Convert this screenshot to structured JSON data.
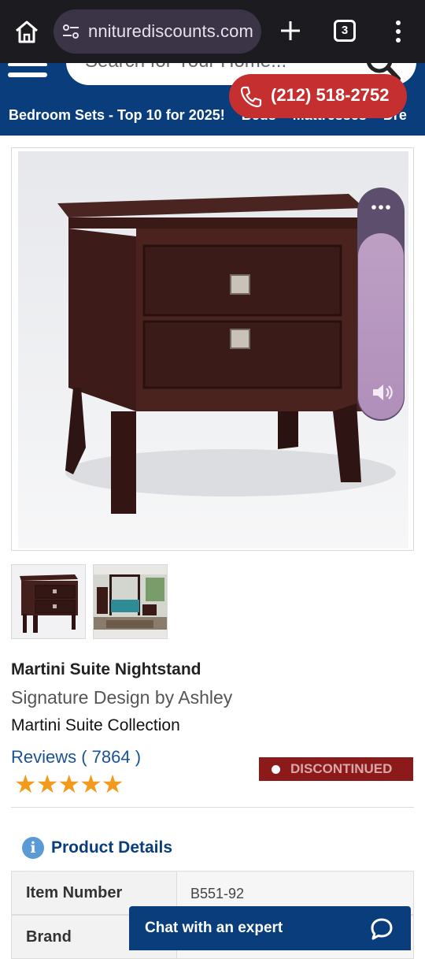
{
  "browser": {
    "url": "nniturediscounts.com",
    "tab_count": "3"
  },
  "header": {
    "search_placeholder": "Search for Your Home...",
    "phone": "(212) 518-2752",
    "nav": [
      "Bedroom Sets - Top 10 for 2025!",
      "Beds",
      "Mattresses",
      "Dre"
    ]
  },
  "product": {
    "title": "Martini Suite Nightstand",
    "brand": "Signature Design by Ashley",
    "collection": "Martini Suite Collection",
    "reviews": "Reviews ( 7864 )",
    "stars": "★★★★★",
    "rating": 5,
    "status": "DISCONTINUED"
  },
  "details": {
    "title": "Product Details",
    "info_glyph": "i",
    "rows": [
      {
        "key": "Item Number",
        "value": "B551-92"
      },
      {
        "key": "Brand",
        "value": ""
      }
    ]
  },
  "chat": {
    "label": "Chat with an expert"
  },
  "colors": {
    "header_blue": "#0a3d7c",
    "phone_red": "#c62f2f",
    "star_orange": "#f39a1c",
    "discontinued_red": "#8c1a1a"
  }
}
